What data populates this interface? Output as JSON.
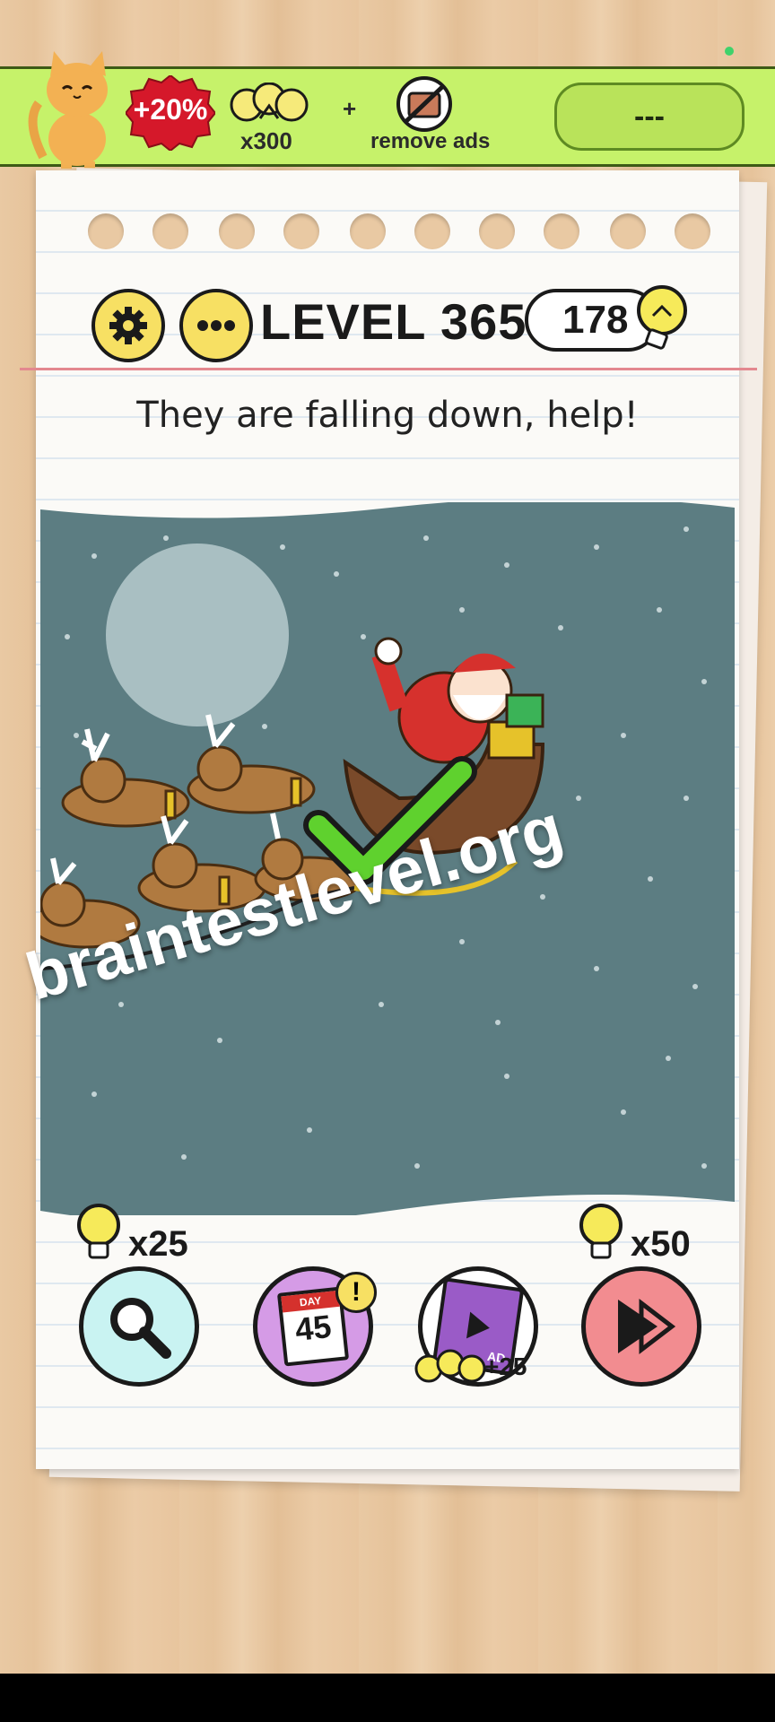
{
  "promo": {
    "discount": "+20%",
    "bulbs_amount": "x300",
    "plus": "+",
    "remove_ads": "remove ads",
    "price_button": "---"
  },
  "header": {
    "level_title": "LEVEL 365",
    "hint_count": "178"
  },
  "question": "They are falling down, help!",
  "watermark": "braintestlevel.org",
  "actions": {
    "search_cost": "x25",
    "daily_label": "DAY",
    "daily_number": "45",
    "daily_alert": "!",
    "ad_label": "AD",
    "ad_reward": "+25",
    "skip_cost": "x50"
  },
  "colors": {
    "promo_green": "#c6f26a",
    "night_sky": "#5c7d82",
    "settings_yellow": "#f7e063",
    "search_cyan": "#c9f3f2",
    "daily_purple": "#d59be6",
    "skip_pink": "#f28c90",
    "check_green": "#5fd12e"
  },
  "icons": [
    "cat-icon",
    "bulb-icon",
    "no-tv-icon",
    "gear-icon",
    "dots-icon",
    "magnifier-icon",
    "calendar-icon",
    "film-icon",
    "play-skip-icon",
    "checkmark-icon",
    "santa-sleigh",
    "reindeer"
  ]
}
